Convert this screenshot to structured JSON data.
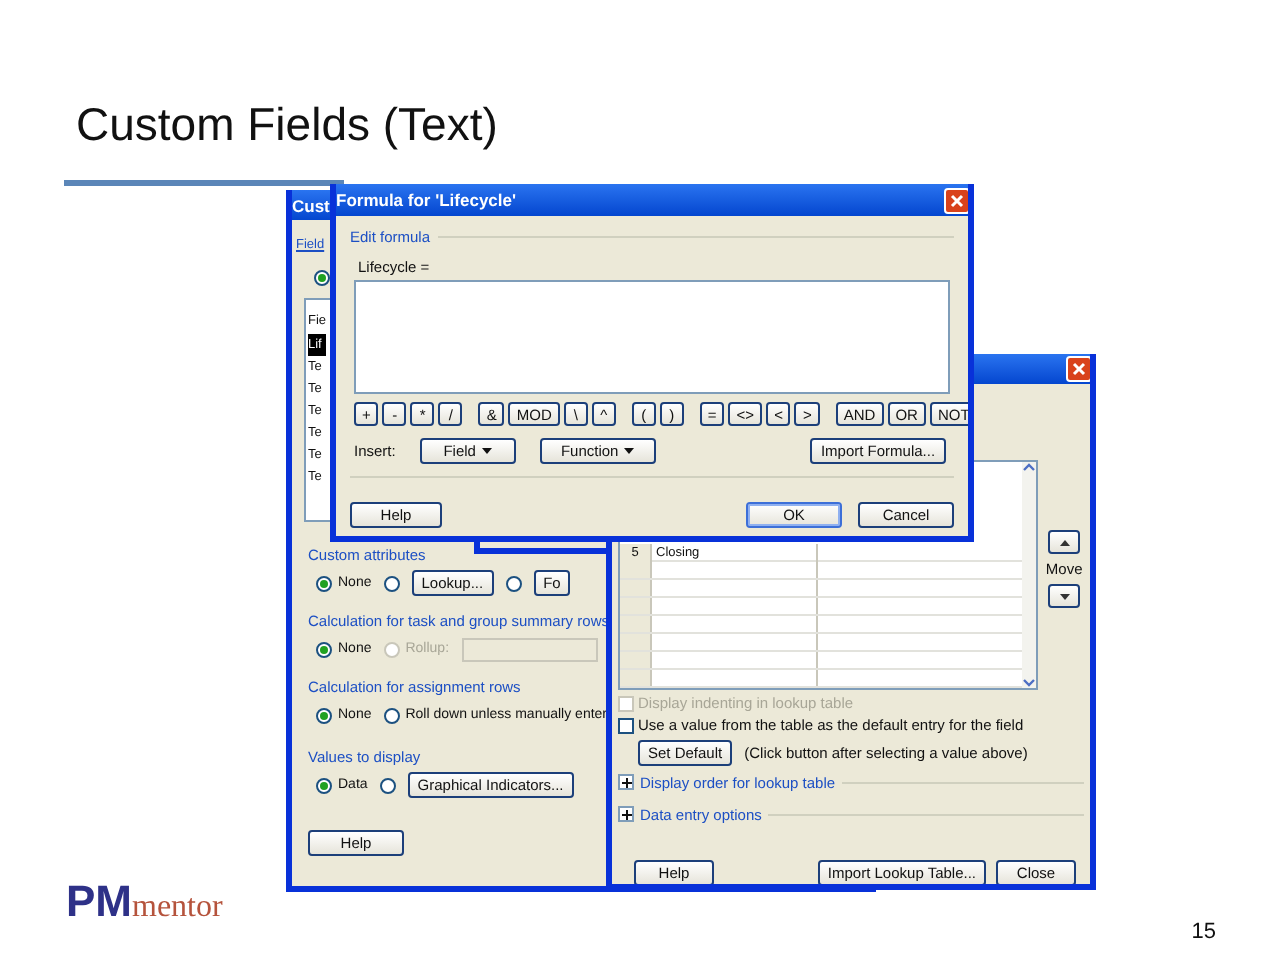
{
  "slide": {
    "title": "Custom Fields (Text)",
    "logo": {
      "strong": "PM",
      "light": "mentor"
    },
    "page_number": "15"
  },
  "custom_fields_window": {
    "title": "Cust",
    "field_label": "Field",
    "field_radio": {
      "selected": true
    },
    "list_header": "Fie",
    "list_items": [
      {
        "label": "Lif",
        "selected": true
      },
      {
        "label": "Te",
        "selected": false
      },
      {
        "label": "Te",
        "selected": false
      },
      {
        "label": "Te",
        "selected": false
      },
      {
        "label": "Te",
        "selected": false
      },
      {
        "label": "Te",
        "selected": false
      },
      {
        "label": "Te",
        "selected": false
      }
    ],
    "sections": [
      {
        "title": "Custom attributes",
        "items": [
          {
            "kind": "radio",
            "label": "None",
            "selected": true,
            "disabled": false
          },
          {
            "kind": "radio",
            "selected": false,
            "disabled": false
          },
          {
            "kind": "button",
            "label": "Lookup..."
          },
          {
            "kind": "radio",
            "selected": false,
            "disabled": false
          },
          {
            "kind": "button",
            "label": "Fo"
          }
        ]
      },
      {
        "title": "Calculation for task and group summary rows",
        "items": [
          {
            "kind": "radio",
            "label": "None",
            "selected": true,
            "disabled": false
          },
          {
            "kind": "radio",
            "label": "Rollup:",
            "selected": false,
            "disabled": true
          },
          {
            "kind": "dropdown",
            "disabled": true
          }
        ]
      },
      {
        "title": "Calculation for assignment rows",
        "items": [
          {
            "kind": "radio",
            "label": "None",
            "selected": true,
            "disabled": false
          },
          {
            "kind": "radio",
            "label": "Roll down unless manually enter",
            "selected": false,
            "disabled": false
          }
        ]
      },
      {
        "title": "Values to display",
        "items": [
          {
            "kind": "radio",
            "label": "Data",
            "selected": true,
            "disabled": false
          },
          {
            "kind": "radio",
            "selected": false,
            "disabled": false
          },
          {
            "kind": "button",
            "label": "Graphical Indicators..."
          }
        ]
      }
    ],
    "help_button": "Help"
  },
  "formula_window": {
    "title": "Formula for 'Lifecycle'",
    "group_label": "Edit formula",
    "formula_label": "Lifecycle =",
    "operator_groups": [
      [
        "+",
        "-",
        "*",
        "/"
      ],
      [
        "&",
        "MOD",
        "\\",
        "^"
      ],
      [
        "(",
        ")"
      ],
      [
        "=",
        "<>",
        "<",
        ">"
      ],
      [
        "AND",
        "OR",
        "NOT"
      ]
    ],
    "insert_label": "Insert:",
    "insert_buttons": [
      {
        "label": "Field",
        "dropdown": true
      },
      {
        "label": "Function",
        "dropdown": true
      },
      {
        "label": "Import Formula...",
        "dropdown": false
      }
    ],
    "buttons": [
      {
        "label": "Help",
        "default": false
      },
      {
        "label": "OK",
        "default": true
      },
      {
        "label": "Cancel",
        "default": false
      }
    ]
  },
  "lookup_window": {
    "table_rows": [
      {
        "number": "5",
        "value": "Closing"
      }
    ],
    "move_label": "Move",
    "checkboxes": [
      {
        "label": "Display indenting in lookup table",
        "checked": false,
        "disabled": true
      },
      {
        "label": "Use a value from the table as the default entry for the field",
        "checked": false,
        "disabled": false
      }
    ],
    "set_default_button": "Set Default",
    "set_default_hint": "(Click button after selecting a value above)",
    "expanders": [
      {
        "label": "Display order for lookup table",
        "expanded": false
      },
      {
        "label": "Data entry options",
        "expanded": false
      }
    ],
    "buttons": [
      {
        "label": "Help"
      },
      {
        "label": "Import Lookup Table..."
      },
      {
        "label": "Close"
      }
    ]
  }
}
